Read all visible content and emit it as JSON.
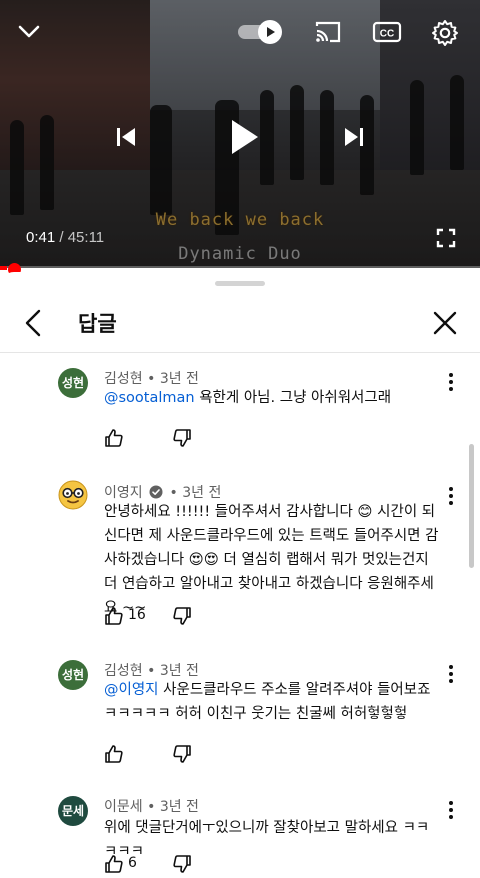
{
  "player": {
    "current_time": "0:41",
    "duration": "45:11",
    "progress_fraction": 0.0151,
    "subtitle_line1": "We back we back",
    "subtitle_line2": "Dynamic Duo",
    "autoplay_on": true,
    "accent_color": "#ff0000"
  },
  "panel": {
    "title": "답글",
    "back_icon": "chevron-left-icon",
    "close_icon": "close-icon"
  },
  "comments": [
    {
      "author": "김성현",
      "age": "3년 전",
      "avatar_text": "성현",
      "mention": "@sootalman",
      "text": " 욕한게 아님. 그냥 아쉬워서그래",
      "likes": ""
    },
    {
      "author": "이영지",
      "age": "3년 전",
      "avatar_text": "",
      "verified": true,
      "text_part1": "안녕하세요 !!!!!! 들어주셔서 감사합니다 😊 시간이 되신다면 제 사운드클라우드에 있는 트랙도 들어주시면 감사하겠습니다 😍😍 더 열심히 랩해서 뭐가 멋있는건지 더 연습하고 알아내고 찾아내고 하겠습니다 응원해주세요 ~~",
      "likes": "16"
    },
    {
      "author": "김성현",
      "age": "3년 전",
      "avatar_text": "성현",
      "mention": "@이영지",
      "text": " 사운드클라우드 주소를 알려주셔야 들어보죠 ㅋㅋㅋㅋㅋ 허허 이친구 웃기는 친굴쎄 허허헣헣헣",
      "likes": ""
    },
    {
      "author": "이문세",
      "age": "3년 전",
      "avatar_text": "문세",
      "text": "위에 댓글단거에ㅜ있으니까 잘찾아보고 말하세요 ㅋㅋㅋㅋㅋ",
      "likes": "6"
    }
  ]
}
